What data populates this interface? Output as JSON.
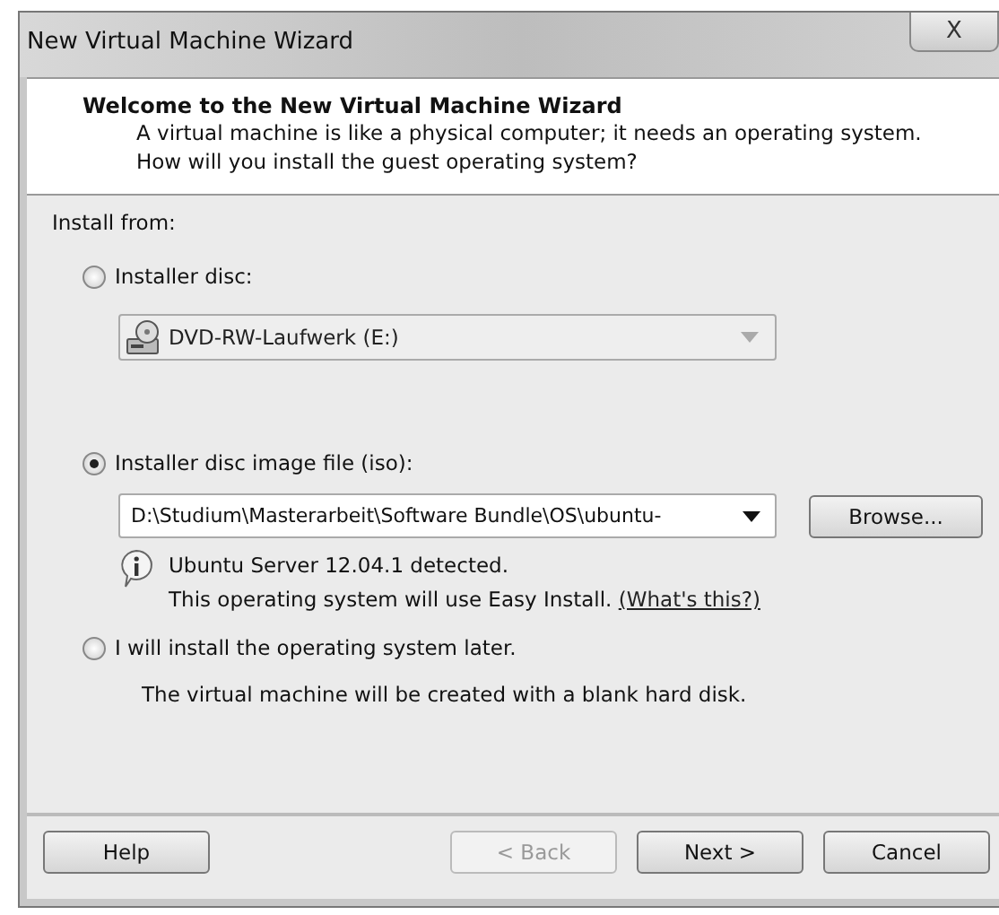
{
  "window": {
    "title": "New Virtual Machine Wizard",
    "close": "X"
  },
  "header": {
    "title": "Welcome to the New Virtual Machine Wizard",
    "text": "A virtual machine is like a physical computer; it needs an operating system. How will you install the guest operating system?"
  },
  "install_from": "Install from:",
  "options": [
    {
      "label": "Installer disc:",
      "selected": false
    },
    {
      "label": "Installer disc image file (iso):",
      "selected": true
    },
    {
      "label": "I will install the operating system later.",
      "selected": false
    }
  ],
  "disc_drive": {
    "value": "DVD-RW-Laufwerk (E:)",
    "disabled": true
  },
  "iso_path": {
    "value": "D:\\Studium\\Masterarbeit\\Software Bundle\\OS\\ubuntu-",
    "browse": "Browse..."
  },
  "detected": {
    "title": "Ubuntu Server 12.04.1 detected.",
    "text": "This operating system will use Easy Install.",
    "link": "(What's this?)"
  },
  "later_note": "The virtual machine will be created with a blank hard disk.",
  "buttons": [
    {
      "label": "Help",
      "disabled": false
    },
    {
      "label": "< Back",
      "disabled": true
    },
    {
      "label": "Next >",
      "disabled": false
    },
    {
      "label": "Cancel",
      "disabled": false
    }
  ]
}
